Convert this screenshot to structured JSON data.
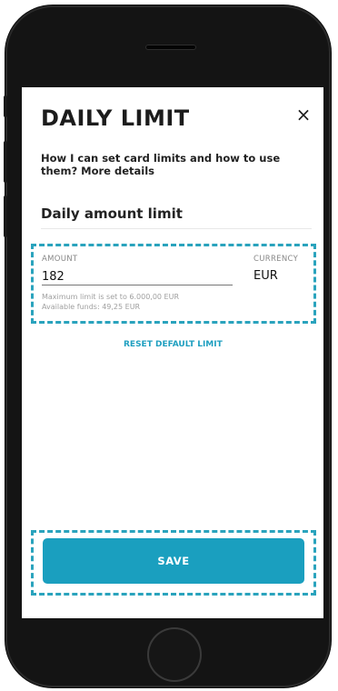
{
  "dialog": {
    "title": "DAILY LIMIT",
    "close_icon": "close-icon",
    "close_glyph": "×",
    "help_text": "How I can set card limits and how to use them? More details"
  },
  "section": {
    "title": "Daily amount limit"
  },
  "amount": {
    "label": "AMOUNT",
    "value": "182",
    "max_hint": "Maximum limit is set to 6.000,00 EUR",
    "funds_hint": "Available funds: 49,25 EUR"
  },
  "currency": {
    "label": "CURRENCY",
    "value": "EUR"
  },
  "reset_label": "RESET DEFAULT LIMIT",
  "save_label": "SAVE",
  "colors": {
    "accent": "#1a9fbf",
    "highlight_dash": "#2aa3bd",
    "phone_body": "#141414"
  }
}
